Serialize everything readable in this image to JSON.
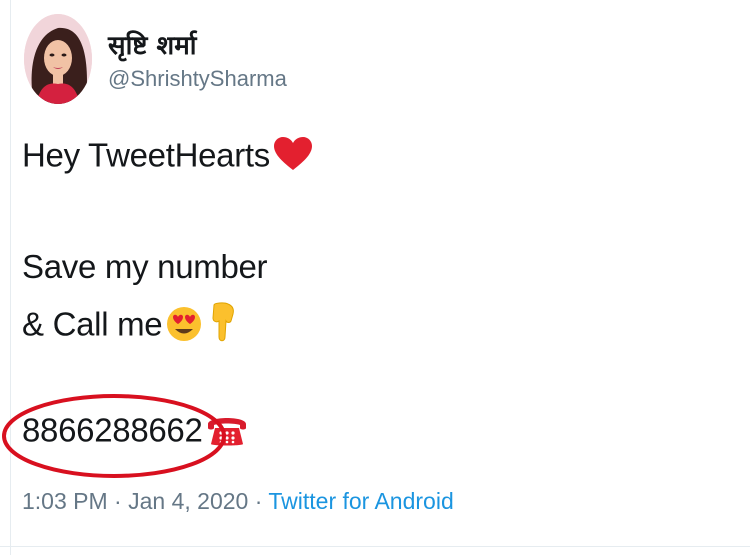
{
  "tweet": {
    "display_name": "सृष्टि शर्मा",
    "handle": "@ShrishtySharma",
    "line1": "Hey TweetHearts",
    "line2": "Save my number",
    "line3": "& Call me",
    "phone": "8866288662",
    "time": "1:03 PM",
    "separator": "·",
    "date": "Jan 4, 2020",
    "source": "Twitter for Android"
  },
  "icons": {
    "heart": "red-heart-icon",
    "heart_eyes": "heart-eyes-emoji-icon",
    "pointing_down": "backhand-pointing-down-icon",
    "telephone": "red-telephone-icon"
  },
  "colors": {
    "annotation_circle": "#d8101f",
    "link": "#1b95e0",
    "muted": "#657786"
  }
}
